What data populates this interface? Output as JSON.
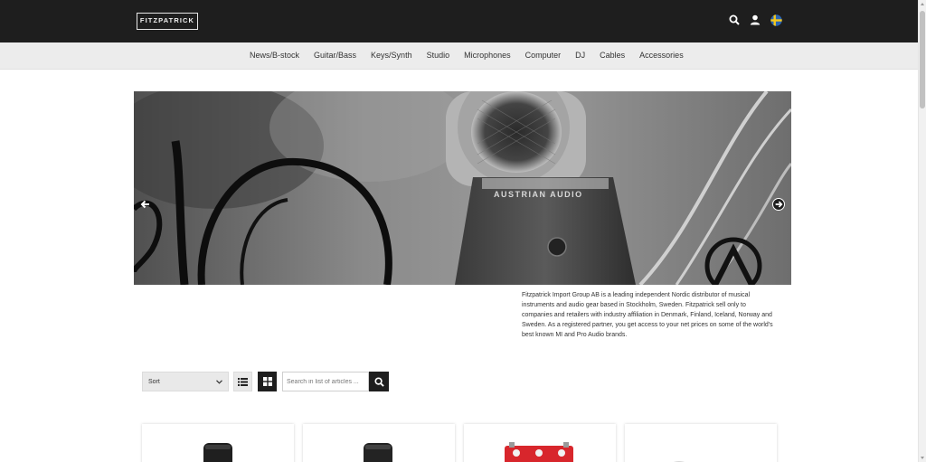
{
  "header": {
    "logo_text": "FITZPATRICK",
    "icons": [
      "search-icon",
      "user-icon",
      "swedish-flag-icon"
    ]
  },
  "nav": {
    "items": [
      "News/B-stock",
      "Guitar/Bass",
      "Keys/Synth",
      "Studio",
      "Microphones",
      "Computer",
      "DJ",
      "Cables",
      "Accessories"
    ]
  },
  "hero": {
    "product_brand_text": "AUSTRIAN AUDIO",
    "prev_icon": "arrow-left-icon",
    "next_icon": "arrow-right-icon"
  },
  "about": {
    "text": "Fitzpatrick Import Group AB is a leading independent Nordic distributor of musical instruments and audio gear based in Stockholm, Sweden. Fitzpatrick sell only to companies and retailers with industry affiliation in Denmark, Finland, Iceland, Norway and Sweden. As a registered partner, you get access to your net prices on some of the world's best known MI and Pro Audio brands."
  },
  "toolbar": {
    "sort_label": "Sort",
    "search_placeholder": "Search in list of articles ...",
    "search_value": ""
  },
  "colors": {
    "header_bg": "#1e1e1e",
    "nav_bg": "#ececec",
    "product_red": "#d8262c"
  }
}
